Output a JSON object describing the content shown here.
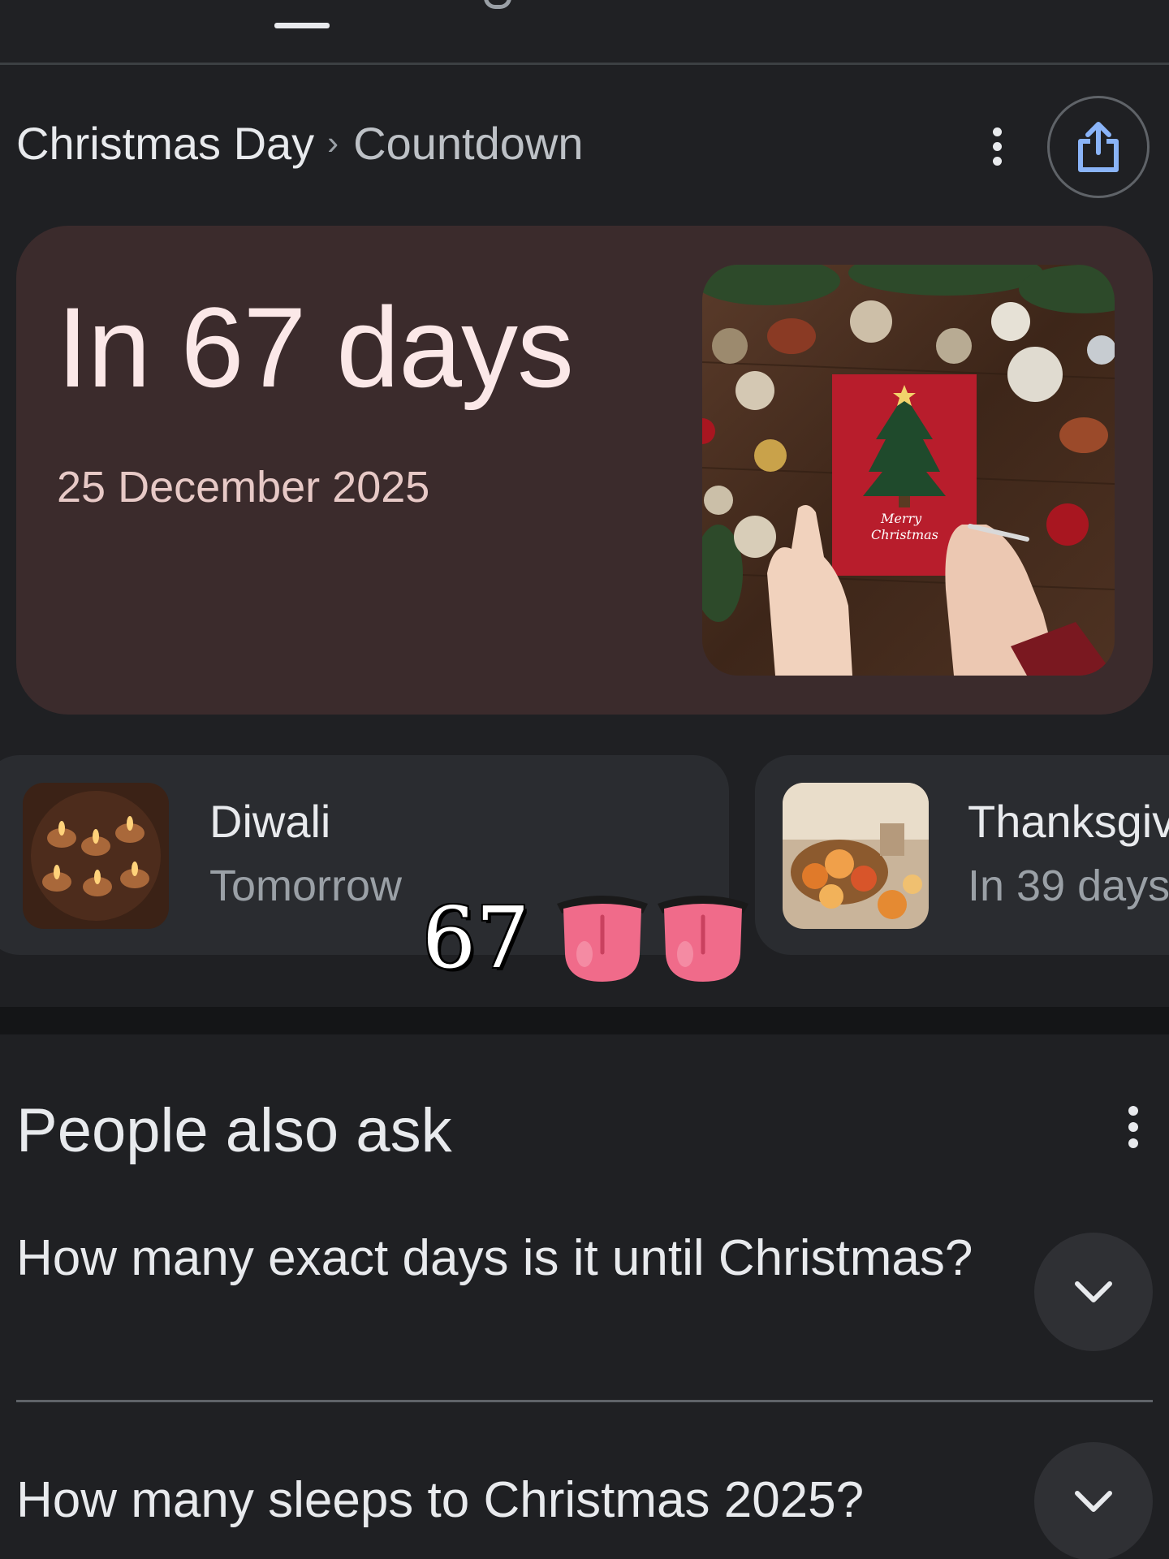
{
  "breadcrumb": {
    "root": "Christmas Day",
    "separator": "›",
    "current": "Countdown"
  },
  "icons": {
    "share": "share-icon",
    "more": "more-vert-icon",
    "expand": "chevron-down-icon"
  },
  "countdown": {
    "headline": "In 67 days",
    "date": "25 December 2025",
    "image": "christmas-card-photo"
  },
  "holidays": [
    {
      "name": "Diwali",
      "when": "Tomorrow",
      "image": "diwali-lamps-photo"
    },
    {
      "name": "Thanksgiv",
      "when": "In 39 days",
      "image": "thanksgiving-harvest-photo"
    }
  ],
  "overlay": {
    "number": "67",
    "emoji": "tongue-emoji"
  },
  "people_also_ask": {
    "title": "People also ask",
    "questions": [
      "How many exact days is it until Christmas?",
      "How many sleeps to Christmas 2025?"
    ]
  },
  "colors": {
    "background": "#1f2023",
    "card": "#3b2b2c",
    "headline": "#fbe8e8",
    "muted": "#9aa0a6"
  }
}
